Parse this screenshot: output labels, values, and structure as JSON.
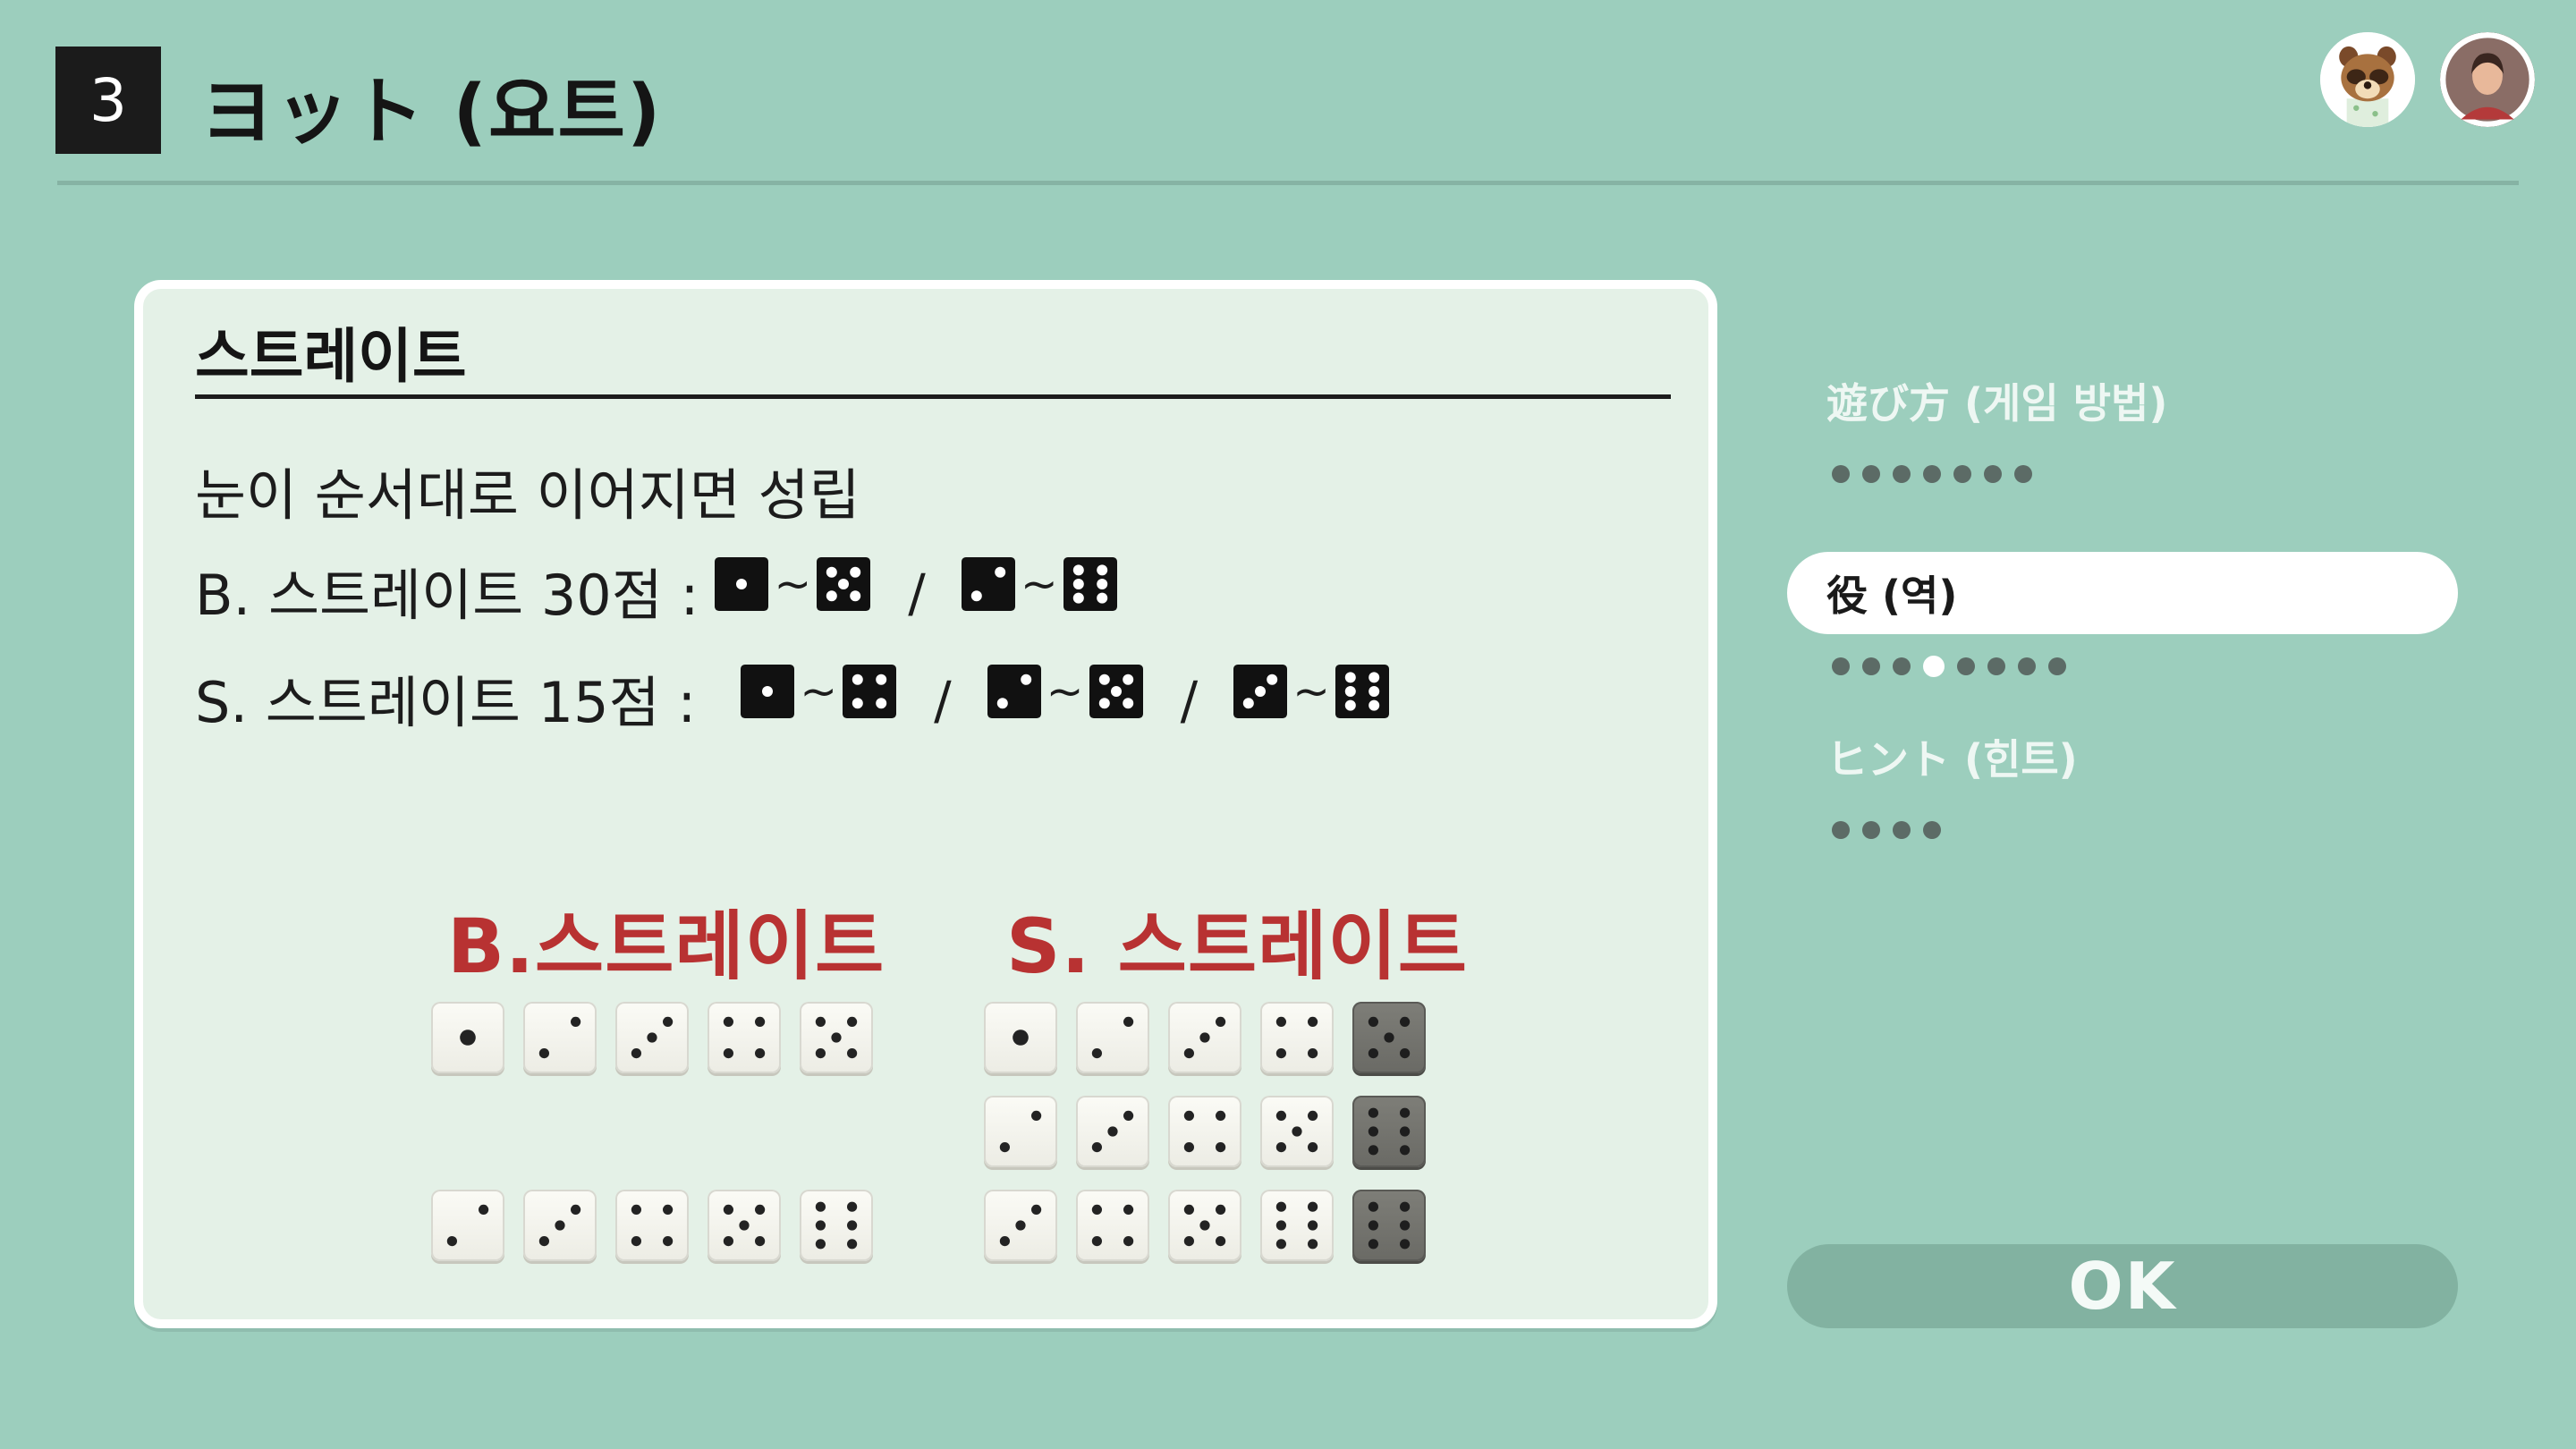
{
  "header": {
    "badge": "3",
    "title": "ヨット (요트)"
  },
  "avatars": [
    "tom-nook-avatar",
    "player-avatar"
  ],
  "panel": {
    "title": "스트레이트",
    "description": "눈이 순서대로 이어지면 성립",
    "b_line": {
      "label": "B. 스트레이트 30점 :",
      "sequences": [
        {
          "from": 1,
          "to": 5
        },
        {
          "from": 2,
          "to": 6
        }
      ]
    },
    "s_line": {
      "label": "S. 스트레이트 15점 :",
      "sequences": [
        {
          "from": 1,
          "to": 4
        },
        {
          "from": 2,
          "to": 5
        },
        {
          "from": 3,
          "to": 6
        }
      ]
    },
    "tilde": "~",
    "slash": "/",
    "b_section_title": "B.스트레이트",
    "s_section_title": "S. 스트레이트",
    "b_examples": [
      [
        1,
        2,
        3,
        4,
        5
      ],
      [
        2,
        3,
        4,
        5,
        6
      ]
    ],
    "s_examples": [
      {
        "dice": [
          1,
          2,
          3,
          4,
          5
        ],
        "dark": 4
      },
      {
        "dice": [
          2,
          3,
          4,
          5,
          6
        ],
        "dark": 4
      },
      {
        "dice": [
          3,
          4,
          5,
          6,
          6
        ],
        "dark": 4
      }
    ]
  },
  "menu": {
    "items": [
      {
        "label": "遊び方 (게임 방법)",
        "dots": 7,
        "current": -1,
        "active": false
      },
      {
        "label": "役 (역)",
        "dots": 8,
        "current": 3,
        "active": true
      },
      {
        "label": "ヒント (힌트)",
        "dots": 4,
        "current": -1,
        "active": false
      }
    ],
    "ok_label": "OK"
  }
}
